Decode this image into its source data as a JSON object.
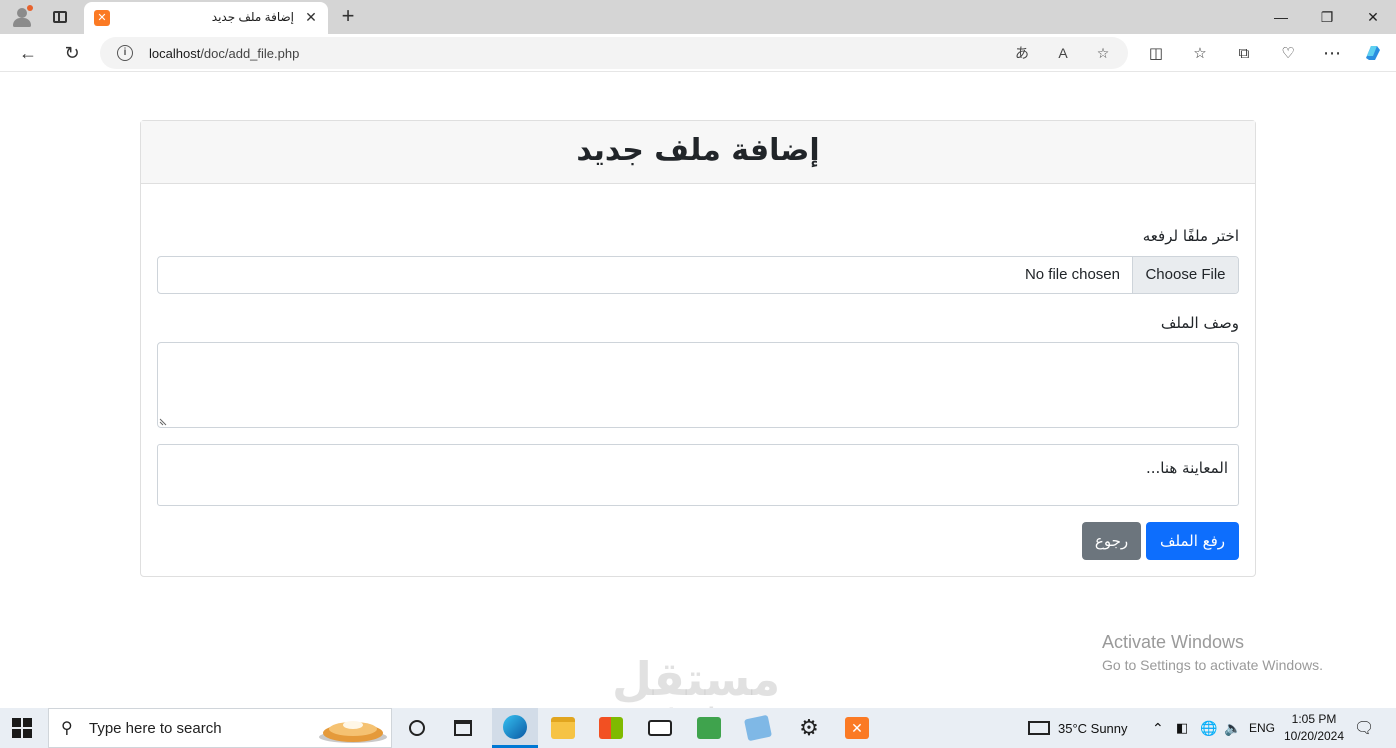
{
  "browser": {
    "tab_title": "إضافة ملف جديد",
    "url_host": "localhost",
    "url_path": "/doc/add_file.php"
  },
  "page": {
    "heading": "إضافة ملف جديد",
    "file_label": "اختر ملفًا لرفعه",
    "file_button": "Choose File",
    "file_status": "No file chosen",
    "description_label": "وصف الملف",
    "description_value": "",
    "preview_text": "المعاينة هنا...",
    "upload_button": "رفع الملف",
    "back_button": "رجوع"
  },
  "overlay": {
    "activate_title": "Activate Windows",
    "activate_sub": "Go to Settings to activate Windows.",
    "logo_text": "مستقل",
    "logo_sub": "mostaql.com"
  },
  "taskbar": {
    "search_placeholder": "Type here to search",
    "weather": "35°C  Sunny",
    "language": "ENG",
    "time": "1:05 PM",
    "date": "10/20/2024"
  },
  "colors": {
    "primary": "#0d6efd",
    "secondary": "#6c757d",
    "xampp": "#fb7a24"
  }
}
